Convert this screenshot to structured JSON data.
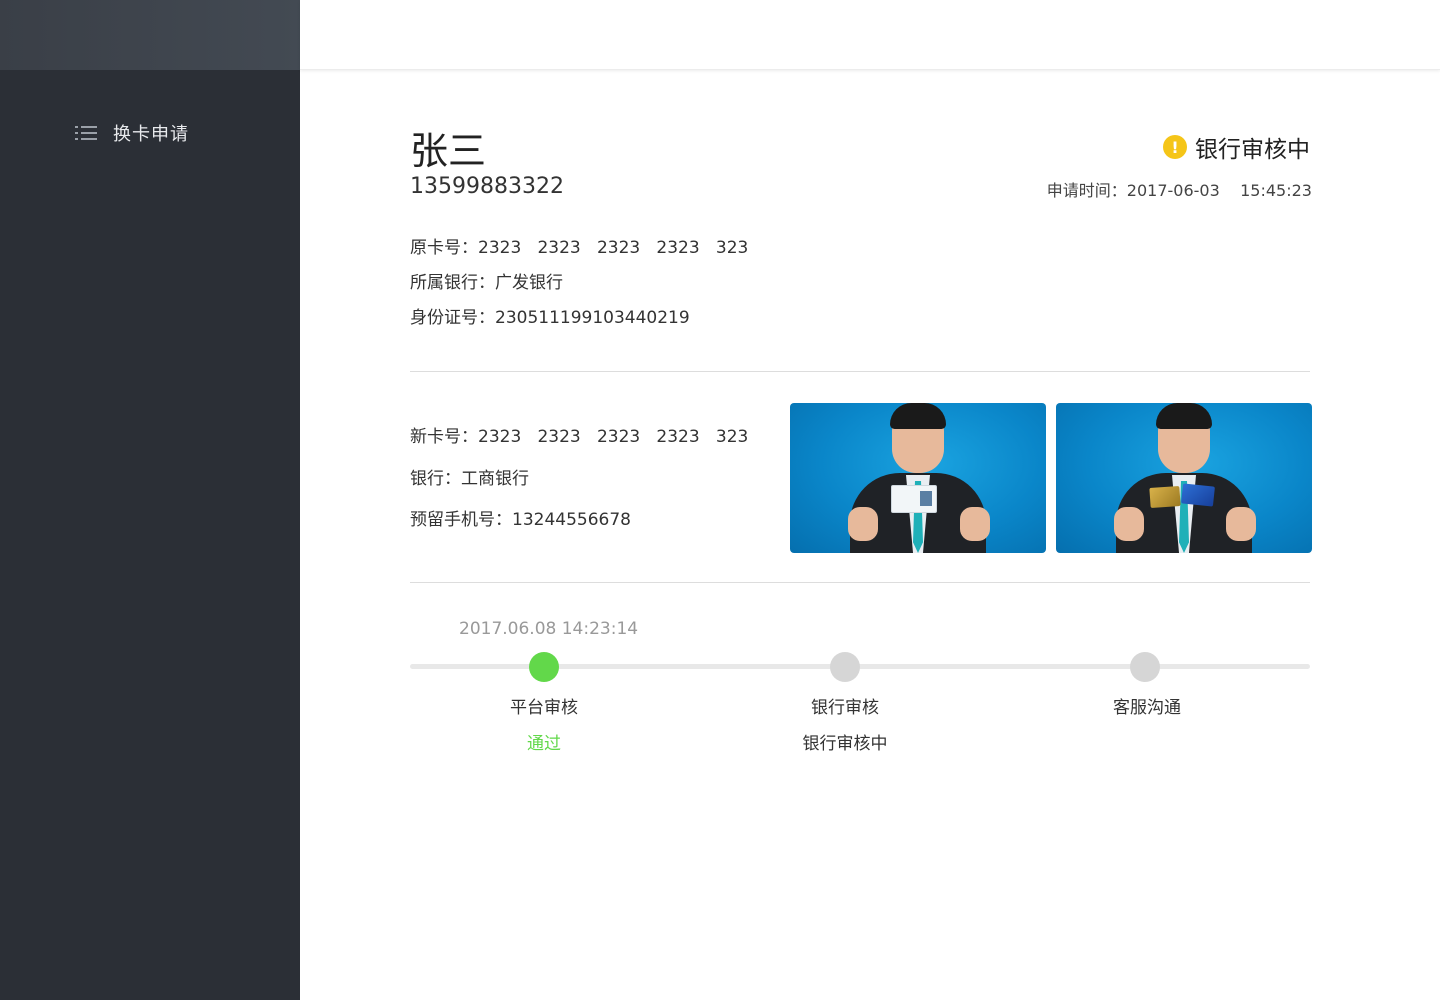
{
  "sidebar": {
    "items": [
      {
        "label": "换卡申请",
        "icon": "list-icon"
      }
    ],
    "bg_color": "#2b2f36"
  },
  "applicant": {
    "name": "张三",
    "phone": "13599883322",
    "status_text": "银行审核中",
    "status_icon": "warning-icon",
    "status_icon_glyph": "!",
    "apply_time": "申请时间：2017-06-03    15:45:23"
  },
  "old_card": {
    "card_number": "原卡号：2323   2323   2323   2323   323",
    "bank": "所属银行：广发银行",
    "id_number": "身份证号：230511199103440219"
  },
  "new_card": {
    "card_number": "新卡号：2323   2323   2323   2323   323",
    "bank": "银行：工商银行",
    "reserved_phone": "预留手机号：13244556678"
  },
  "photos": [
    {
      "name": "id-card-photo"
    },
    {
      "name": "bank-card-photo"
    }
  ],
  "progress": {
    "timestamp": "2017.06.08 14:23:14",
    "steps": [
      {
        "label": "平台审核",
        "status": "通过",
        "done": true
      },
      {
        "label": "银行审核",
        "status": "银行审核中",
        "done": false
      },
      {
        "label": "客服沟通",
        "status": "",
        "done": false
      }
    ]
  },
  "colors": {
    "accent_green": "#62d84a",
    "warning_yellow": "#f5c518"
  }
}
